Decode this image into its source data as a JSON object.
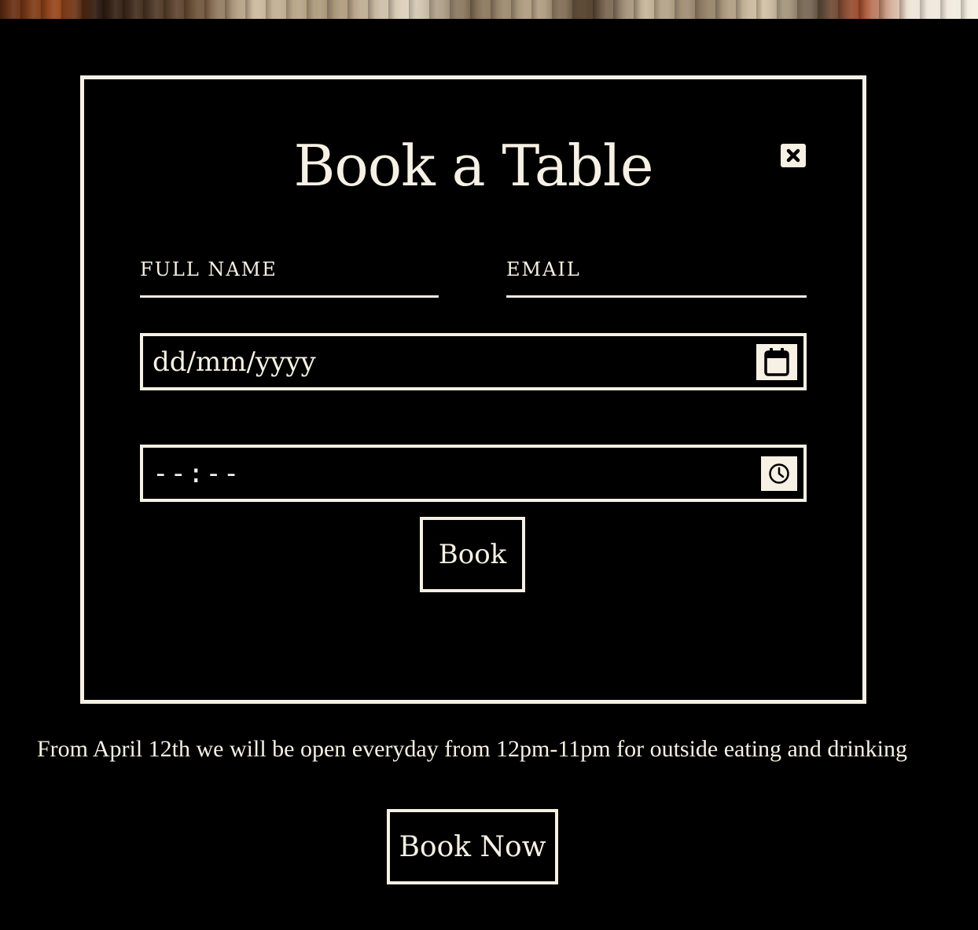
{
  "modal": {
    "title": "Book a Table",
    "close_icon": "close-icon",
    "fields": {
      "full_name_label": "FULL NAME",
      "email_label": "EMAIL",
      "date_placeholder": "dd/mm/yyyy",
      "time_placeholder": "--:--"
    },
    "submit_label": "Book"
  },
  "notice_text": "From April 12th we will be open everyday from 12pm-11pm for outside eating and drinking",
  "book_now_label": "Book Now",
  "colors": {
    "background": "#000000",
    "foreground": "#f7f0e4"
  }
}
